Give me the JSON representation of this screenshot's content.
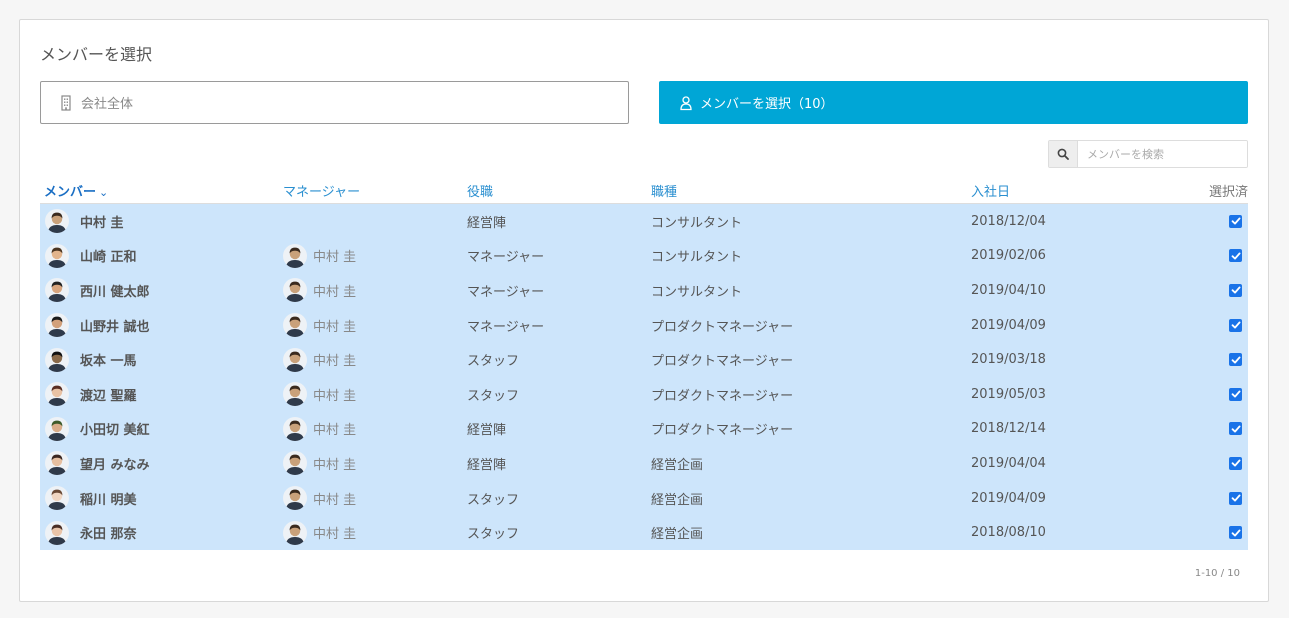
{
  "panel": {
    "title": "メンバーを選択"
  },
  "scope": {
    "label": "会社全体",
    "icon": "building-icon"
  },
  "select_button": {
    "label": "メンバーを選択（10）",
    "icon": "person-icon",
    "color": "#00a6d6"
  },
  "search": {
    "placeholder": "メンバーを検索",
    "icon": "search-icon"
  },
  "columns": {
    "member": "メンバー",
    "manager": "マネージャー",
    "role": "役職",
    "job": "職種",
    "joined": "入社日",
    "selected": "選択済"
  },
  "rows": [
    {
      "name": "中村 圭",
      "manager": "",
      "role": "経営陣",
      "job": "コンサルタント",
      "joined": "2018/12/04",
      "checked": true,
      "avatar_color": "#c9a17a",
      "hair": "#3a2a1e"
    },
    {
      "name": "山崎 正和",
      "manager": "中村 圭",
      "role": "マネージャー",
      "job": "コンサルタント",
      "joined": "2019/02/06",
      "checked": true,
      "avatar_color": "#e2b48c",
      "hair": "#4a3420"
    },
    {
      "name": "西川 健太郎",
      "manager": "中村 圭",
      "role": "マネージャー",
      "job": "コンサルタント",
      "joined": "2019/04/10",
      "checked": true,
      "avatar_color": "#d8a57e",
      "hair": "#222222"
    },
    {
      "name": "山野井 誠也",
      "manager": "中村 圭",
      "role": "マネージャー",
      "job": "プロダクトマネージャー",
      "joined": "2019/04/09",
      "checked": true,
      "avatar_color": "#d2a07a",
      "hair": "#1a1a1a"
    },
    {
      "name": "坂本 一馬",
      "manager": "中村 圭",
      "role": "スタッフ",
      "job": "プロダクトマネージャー",
      "joined": "2019/03/18",
      "checked": true,
      "avatar_color": "#8a6a4a",
      "hair": "#111111"
    },
    {
      "name": "渡辺 聖羅",
      "manager": "中村 圭",
      "role": "スタッフ",
      "job": "プロダクトマネージャー",
      "joined": "2019/05/03",
      "checked": true,
      "avatar_color": "#e8c2a4",
      "hair": "#5a2e22"
    },
    {
      "name": "小田切 美紅",
      "manager": "中村 圭",
      "role": "経営陣",
      "job": "プロダクトマネージャー",
      "joined": "2018/12/14",
      "checked": true,
      "avatar_color": "#d9ad8a",
      "hair": "#3d5a2a"
    },
    {
      "name": "望月 みなみ",
      "manager": "中村 圭",
      "role": "経営陣",
      "job": "経営企画",
      "joined": "2019/04/04",
      "checked": true,
      "avatar_color": "#e6bfa0",
      "hair": "#3a2620"
    },
    {
      "name": "稲川 明美",
      "manager": "中村 圭",
      "role": "スタッフ",
      "job": "経営企画",
      "joined": "2019/04/09",
      "checked": true,
      "avatar_color": "#f0d6c2",
      "hair": "#6a4a36"
    },
    {
      "name": "永田 那奈",
      "manager": "中村 圭",
      "role": "スタッフ",
      "job": "経営企画",
      "joined": "2018/08/10",
      "checked": true,
      "avatar_color": "#e9c4a8",
      "hair": "#4a2e24"
    }
  ],
  "manager_avatar": {
    "avatar_color": "#c9a17a",
    "hair": "#3a2a1e"
  },
  "pagination": "1-10 / 10"
}
